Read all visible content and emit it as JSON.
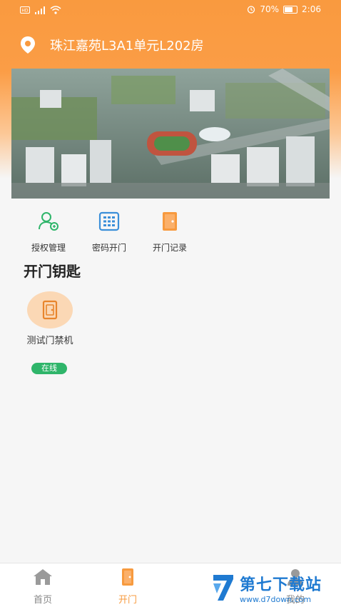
{
  "status_bar": {
    "battery_text": "70%",
    "time": "2:06",
    "battery_level": 0.7
  },
  "header": {
    "address": "珠江嘉苑L3A1单元L202房"
  },
  "quick_actions": [
    {
      "label": "授权管理",
      "icon": "user-auth-icon"
    },
    {
      "label": "密码开门",
      "icon": "keypad-icon"
    },
    {
      "label": "开门记录",
      "icon": "door-record-icon"
    }
  ],
  "keys_section": {
    "title": "开门钥匙",
    "items": [
      {
        "label": "测试门禁机",
        "status": "在线",
        "icon": "door-icon"
      }
    ]
  },
  "tab_bar": {
    "tabs": [
      {
        "label": "首页",
        "icon": "home-icon",
        "active": false
      },
      {
        "label": "开门",
        "icon": "door-icon",
        "active": true
      },
      {
        "label": "我的",
        "icon": "profile-icon",
        "active": false
      }
    ]
  },
  "watermark": {
    "title": "第七下载站",
    "url": "www.d7down.com"
  },
  "colors": {
    "primary": "#F79A3E",
    "online": "#2FB56A",
    "accent_blue": "#3B8FD9"
  }
}
